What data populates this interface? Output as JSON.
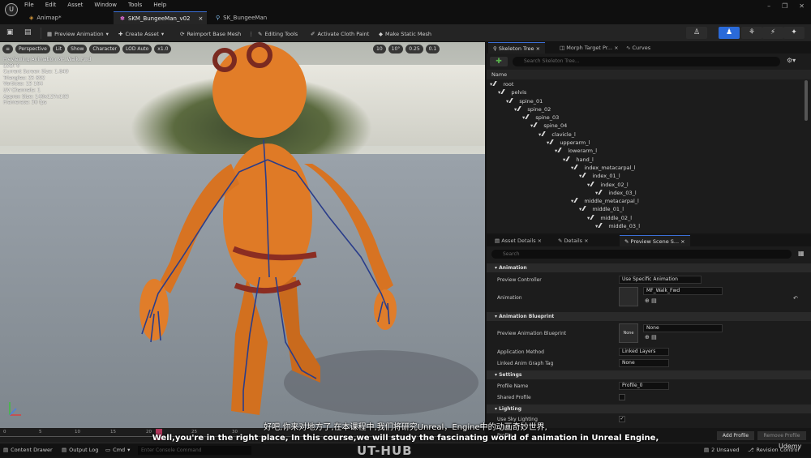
{
  "menu": [
    "File",
    "Edit",
    "Asset",
    "Window",
    "Tools",
    "Help"
  ],
  "tabs": [
    {
      "label": "Animap*",
      "active": false
    },
    {
      "label": "SKM_BungeeMan_v02",
      "active": true
    },
    {
      "label": "SK_BungeeMan",
      "active": false
    }
  ],
  "toolbar": {
    "preview_animation": "Preview Animation",
    "create_asset": "Create Asset",
    "reimport": "Reimport Base Mesh",
    "editing_tools": "Editing Tools",
    "activate_cloth": "Activate Cloth Paint",
    "make_static": "Make Static Mesh"
  },
  "viewport": {
    "buttons": [
      "Perspective",
      "Lit",
      "Show",
      "Character",
      "LOD Auto",
      "x1.0"
    ],
    "right_values": [
      "10",
      "10°",
      "0.25",
      "0.1"
    ],
    "stats": [
      "Previewing Animation MF_Walk_Fwd",
      "LOD: 0",
      "Current Screen Size: 1.849",
      "Triangles: 25 892",
      "Vertices: 13 164",
      "UV Channels: 1",
      "Approx Size: 140x127x163",
      "Framerate: 30 fps"
    ]
  },
  "skeleton_panel": {
    "tabs": [
      "Skeleton Tree",
      "Morph Target Pr...",
      "Curves"
    ],
    "search_placeholder": "Search Skeleton Tree...",
    "column_header": "Name",
    "bones": [
      {
        "name": "root",
        "depth": 0
      },
      {
        "name": "pelvis",
        "depth": 1
      },
      {
        "name": "spine_01",
        "depth": 2
      },
      {
        "name": "spine_02",
        "depth": 3
      },
      {
        "name": "spine_03",
        "depth": 4
      },
      {
        "name": "spine_04",
        "depth": 5
      },
      {
        "name": "clavicle_l",
        "depth": 6
      },
      {
        "name": "upperarm_l",
        "depth": 7
      },
      {
        "name": "lowerarm_l",
        "depth": 8
      },
      {
        "name": "hand_l",
        "depth": 9
      },
      {
        "name": "index_metacarpal_l",
        "depth": 10
      },
      {
        "name": "index_01_l",
        "depth": 11
      },
      {
        "name": "index_02_l",
        "depth": 12
      },
      {
        "name": "index_03_l",
        "depth": 13
      },
      {
        "name": "middle_metacarpal_l",
        "depth": 10
      },
      {
        "name": "middle_01_l",
        "depth": 11
      },
      {
        "name": "middle_02_l",
        "depth": 12
      },
      {
        "name": "middle_03_l",
        "depth": 13
      }
    ]
  },
  "details_panel": {
    "tabs": [
      "Asset Details",
      "Details",
      "Preview Scene S..."
    ],
    "search_placeholder": "Search",
    "categories": {
      "animation": "Animation",
      "anim_blueprint": "Animation Blueprint",
      "settings": "Settings",
      "lighting": "Lighting"
    },
    "props": {
      "preview_controller_label": "Preview Controller",
      "preview_controller_value": "Use Specific Animation",
      "animation_label": "Animation",
      "animation_value": "MF_Walk_Fwd",
      "preview_bp_label": "Preview Animation Blueprint",
      "preview_bp_thumb": "None",
      "preview_bp_value": "None",
      "app_method_label": "Application Method",
      "app_method_value": "Linked Layers",
      "linked_tag_label": "Linked Anim Graph Tag",
      "linked_tag_value": "None",
      "profile_name_label": "Profile Name",
      "profile_name_value": "Profile_0",
      "shared_profile_label": "Shared Profile",
      "use_sky_label": "Use Sky Lighting",
      "profile_label": "Profile",
      "add_profile": "Add Profile",
      "remove_profile": "Remove Profile"
    }
  },
  "timeline": {
    "ticks": [
      "0",
      "5",
      "10",
      "15",
      "20",
      "25",
      "30"
    ]
  },
  "statusbar": {
    "content_drawer": "Content Drawer",
    "output_log": "Output Log",
    "cmd": "Cmd",
    "console_placeholder": "Enter Console Command",
    "unsaved": "2 Unsaved",
    "revision": "Revision Control"
  },
  "subtitles": {
    "cn": "好吧,你来对地方了,在本课程中,我们将研究Unreal，Engine中的动画奇妙世界,",
    "en": "Well,you're in the right place, In this course,we will study the fascinating world of animation in Unreal Engine,"
  },
  "watermark": "UT-HUB",
  "udemy": "Udemy",
  "colors": {
    "accent": "#2a6ad9",
    "character": "#d9782a"
  }
}
